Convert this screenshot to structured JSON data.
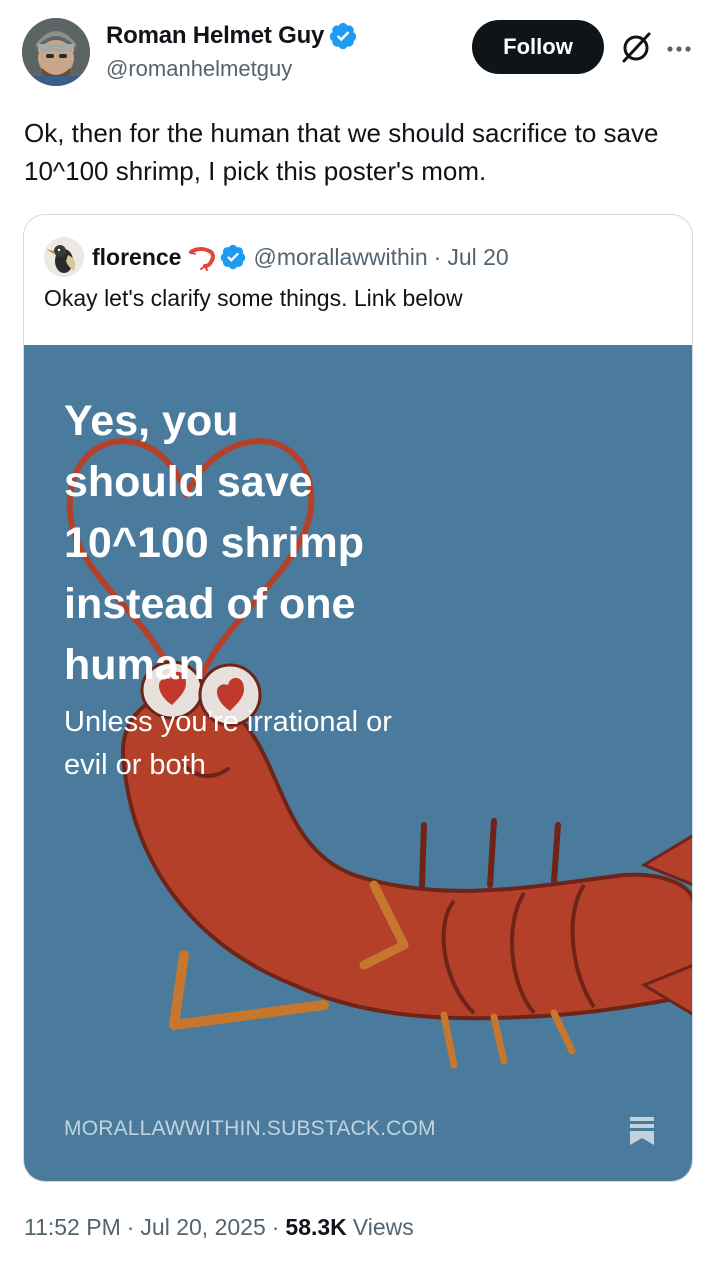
{
  "author": {
    "display_name": "Roman Helmet Guy",
    "handle": "@romanhelmetguy",
    "verified": true
  },
  "actions": {
    "follow_label": "Follow"
  },
  "tweet": {
    "text": "Ok, then for the human that we should sacrifice to save 10^100 shrimp, I pick this poster's mom."
  },
  "quote": {
    "display_name": "florence",
    "handle": "@morallawwithin",
    "separator": "·",
    "date": "Jul 20",
    "text": "Okay let's clarify some things. Link below",
    "media": {
      "headline": "Yes, you\nshould save\n10^100 shrimp\ninstead of one\nhuman",
      "subheadline": "Unless you're irrational or\nevil or both",
      "link_domain": "MORALLAWWITHIN.SUBSTACK.COM",
      "background_color": "#4a7b9c"
    }
  },
  "footer": {
    "time": "11:52 PM",
    "sep1": "·",
    "date": "Jul 20, 2025",
    "sep2": "·",
    "views_count": "58.3K",
    "views_label": "Views"
  },
  "colors": {
    "verified_blue": "#1d9bf0",
    "text_primary": "#0f1419",
    "text_secondary": "#536471",
    "shrimp_red": "#b4402a"
  }
}
